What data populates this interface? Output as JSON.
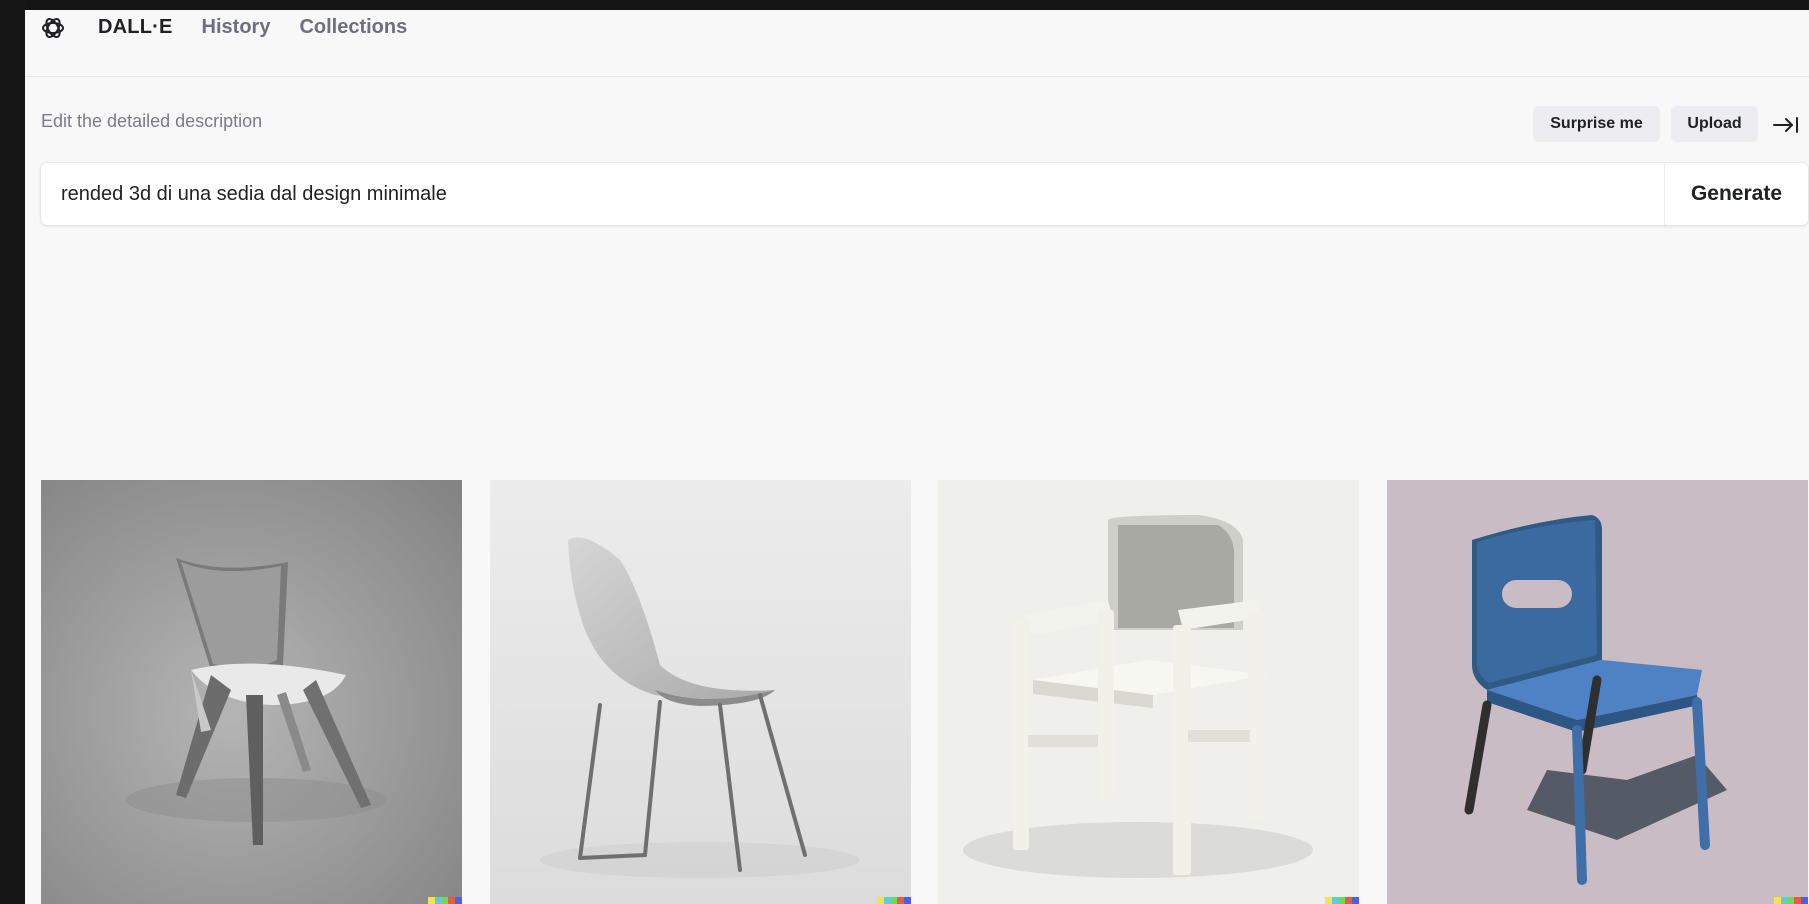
{
  "header": {
    "logo_icon": "openai-logo-icon",
    "nav": [
      {
        "label": "DALL·E"
      },
      {
        "label": "History"
      },
      {
        "label": "Collections"
      }
    ]
  },
  "prompt": {
    "label": "Edit the detailed description",
    "value": "rended 3d di una sedia dal design minimale",
    "surprise_label": "Surprise me",
    "upload_label": "Upload",
    "collapse_icon": "collapse-right-icon",
    "generate_label": "Generate"
  },
  "results": [
    {
      "name": "generated-image-1",
      "background": "#9a9a9a"
    },
    {
      "name": "generated-image-2",
      "background": "#e6e6e6"
    },
    {
      "name": "generated-image-3",
      "background": "#efefec"
    },
    {
      "name": "generated-image-4",
      "background": "#c9bcc5"
    }
  ],
  "watermark_colors": [
    "#f4e34a",
    "#5fd0c9",
    "#6adb5a",
    "#e85b3c",
    "#4a5ee8"
  ]
}
